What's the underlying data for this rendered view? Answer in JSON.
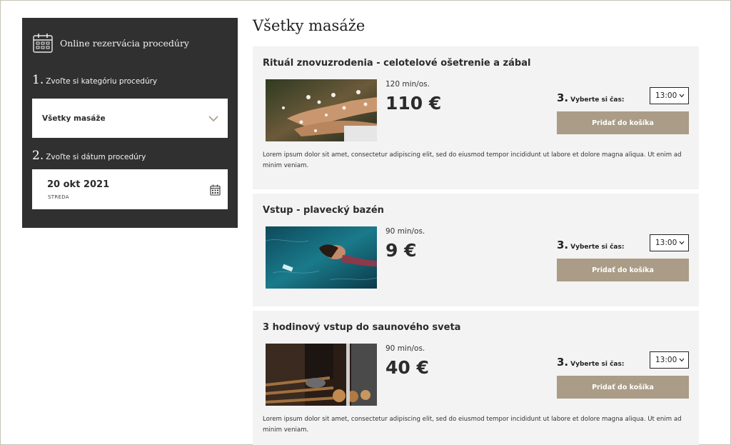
{
  "sidebar": {
    "title": "Online rezervácia procedúry",
    "step1": {
      "number": "1.",
      "label": "Zvoľte si kategóriu procedúry"
    },
    "category_value": "Všetky masáže",
    "step2": {
      "number": "2.",
      "label": "Zvoľte si dátum procedúry"
    },
    "date_value": "20 okt 2021",
    "day_value": "STREDA"
  },
  "main": {
    "title": "Všetky masáže",
    "time_step_number": "3.",
    "time_step_label": "Vyberte si čas:",
    "add_button_label": "Pridať do košíka",
    "procedures": [
      {
        "title": "Rituál znovuzrodenia - celotelové ošetrenie a zábal",
        "duration": "120 min/os.",
        "price": "110 €",
        "time": "13:00",
        "description": "Lorem ipsum dolor sit amet, consectetur adipiscing elit, sed do eiusmod tempor incididunt ut labore et dolore magna aliqua. Ut enim ad minim veniam."
      },
      {
        "title": "Vstup - plavecký bazén",
        "duration": "90 min/os.",
        "price": "9 €",
        "time": "13:00",
        "description": ""
      },
      {
        "title": "3 hodinový vstup do saunového sveta",
        "duration": "90 min/os.",
        "price": "40 €",
        "time": "13:00",
        "description": "Lorem ipsum dolor sit amet, consectetur adipiscing elit, sed do eiusmod tempor incididunt ut labore et dolore magna aliqua. Ut enim ad minim veniam."
      }
    ]
  },
  "icons": {
    "header": "calendar-icon",
    "date_field": "calendar-icon",
    "dropdown": "chevron-down-icon"
  },
  "colors": {
    "sidebar_bg": "#303030",
    "card_bg": "#f3f3f3",
    "button_bg": "#aa9c86",
    "chevron": "#aa9c86"
  }
}
